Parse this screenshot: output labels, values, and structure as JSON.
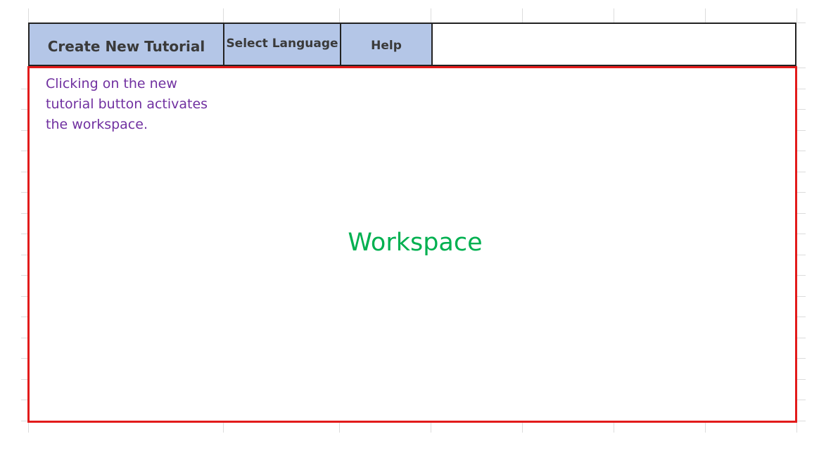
{
  "toolbar": {
    "create_label": "Create New Tutorial",
    "language_label": "Select Language",
    "help_label": "Help"
  },
  "workspace": {
    "title": "Workspace",
    "note": "Clicking on the new tutorial button activates the workspace."
  },
  "colors": {
    "button_fill": "#b4c6e7",
    "workspace_border": "#e21b1b",
    "note_text": "#7030a0",
    "title_text": "#00b050"
  }
}
